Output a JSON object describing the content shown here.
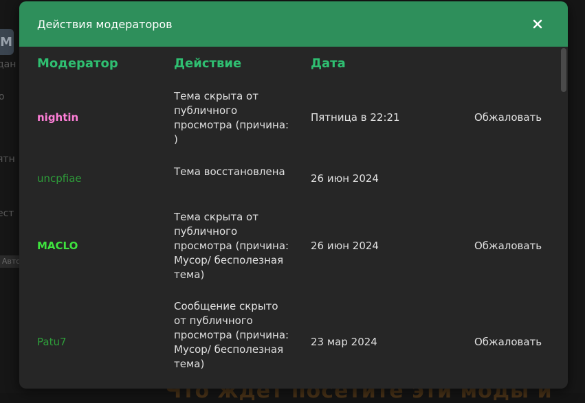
{
  "background": {
    "avatar_letter": "M",
    "fragments": [
      "дан",
      "о",
      "ятн",
      "ест"
    ],
    "badge": "Авто",
    "bottom_text": "Что ждёт посетите эти моды и"
  },
  "modal": {
    "title": "Действия модераторов",
    "close_icon": "close-icon",
    "header_color": "#2e8f5b",
    "columns": {
      "moderator": "Модератор",
      "action": "Действие",
      "date": "Дата"
    },
    "rows": [
      {
        "moderator": "nightin",
        "moderator_color": "#ff7fd8",
        "action": "Тема скрыта от публичного просмотра (причина: )",
        "date": "Пятница в 22:21",
        "appeal": "Обжаловать"
      },
      {
        "moderator": "uncpfiae",
        "moderator_color": "#2e9e3a",
        "action": "Тема восстановлена",
        "date": "26 июн 2024",
        "appeal": ""
      },
      {
        "moderator": "MACLO",
        "moderator_color": "#3ee23e",
        "action": "Тема скрыта от публичного просмотра (причина: Мусор/ бесполезная тема)",
        "date": "26 июн 2024",
        "appeal": "Обжаловать"
      },
      {
        "moderator": "Patu7",
        "moderator_color": "#2e9e3a",
        "action": "Сообщение скрыто от публичного просмотра (причина: Мусор/ бесполезная тема)",
        "date": "23 мар 2024",
        "appeal": "Обжаловать"
      }
    ]
  }
}
